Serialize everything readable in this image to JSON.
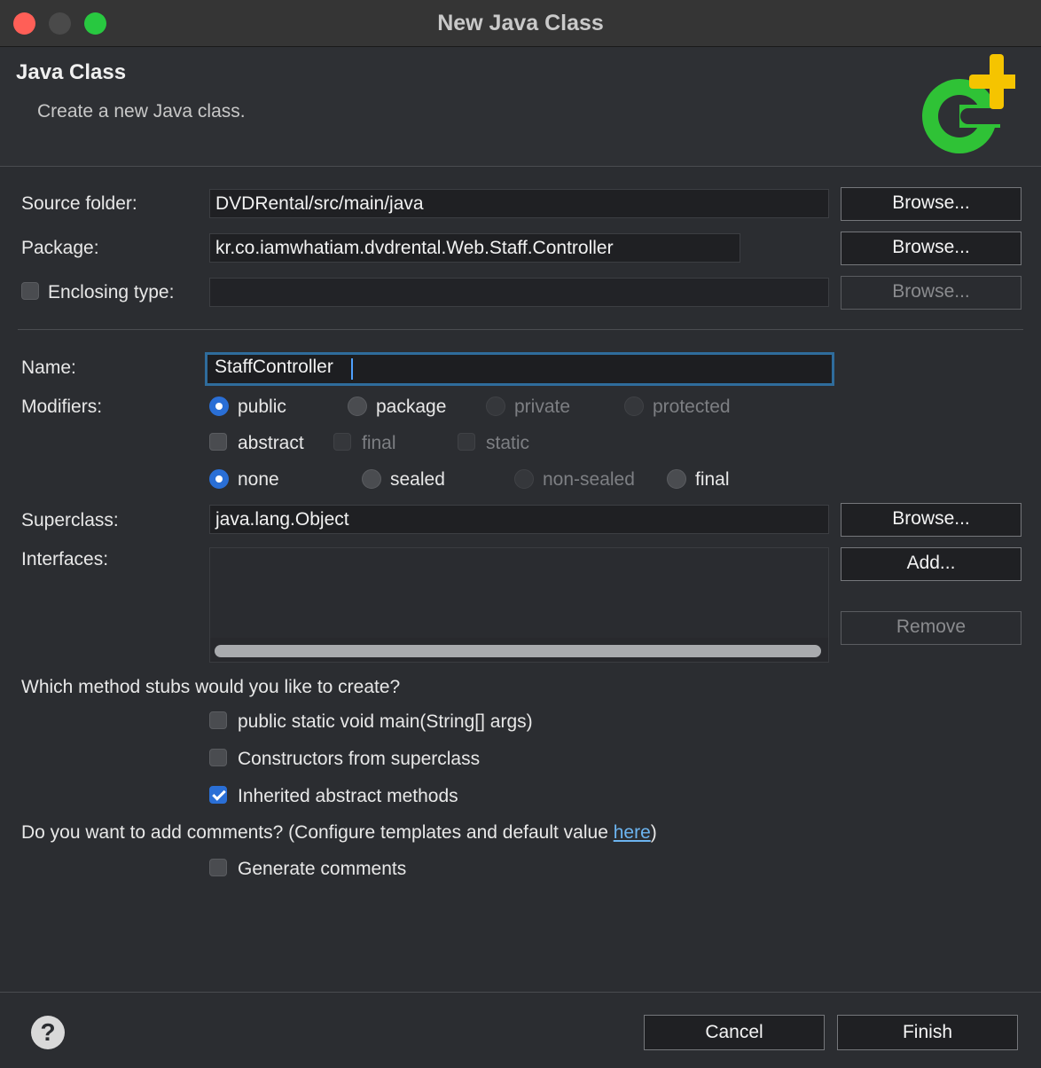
{
  "window": {
    "title": "New Java Class"
  },
  "header": {
    "title": "Java Class",
    "subtitle": "Create a new Java class.",
    "icon": "new-class-icon",
    "icon_colors": {
      "circle": "#2fc236",
      "plus": "#f5c400"
    }
  },
  "source_folder": {
    "label": "Source folder:",
    "value": "DVDRental/src/main/java",
    "browse": "Browse..."
  },
  "package": {
    "label": "Package:",
    "value": "kr.co.iamwhatiam.dvdrental.Web.Staff.Controller",
    "browse": "Browse..."
  },
  "enclosing": {
    "label": "Enclosing type:",
    "value": "",
    "browse": "Browse...",
    "checked": false
  },
  "name": {
    "label": "Name:",
    "value": "StaffController"
  },
  "modifiers": {
    "label": "Modifiers:",
    "access": [
      "public",
      "package",
      "private",
      "protected"
    ],
    "flags": [
      "abstract",
      "final",
      "static"
    ],
    "sealing": [
      "none",
      "sealed",
      "non-sealed",
      "final"
    ]
  },
  "superclass": {
    "label": "Superclass:",
    "value": "java.lang.Object",
    "browse": "Browse..."
  },
  "interfaces": {
    "label": "Interfaces:",
    "add": "Add...",
    "remove": "Remove"
  },
  "stubs": {
    "question": "Which method stubs would you like to create?",
    "main": "public static void main(String[] args)",
    "constructors": "Constructors from superclass",
    "inherited": "Inherited abstract methods"
  },
  "comments": {
    "question_prefix": "Do you want to add comments? (Configure templates and default value ",
    "link": "here",
    "question_suffix": ")",
    "generate": "Generate comments"
  },
  "footer": {
    "help": "?",
    "cancel": "Cancel",
    "finish": "Finish"
  },
  "colors": {
    "accent": "#2a6fd6",
    "link": "#6cb4f0",
    "background": "#2b2d31"
  }
}
